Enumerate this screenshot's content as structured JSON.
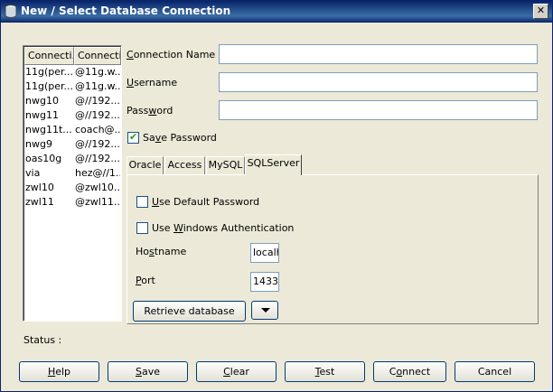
{
  "window": {
    "title": "New / Select Database Connection",
    "close_glyph": "✕"
  },
  "connections": {
    "columns": [
      "Connecti...",
      "Connecti..."
    ],
    "rows": [
      {
        "name": "11g(per...",
        "conn": "@11g.w..."
      },
      {
        "name": "11g(per...",
        "conn": "@11g.w..."
      },
      {
        "name": "nwg10",
        "conn": "@//192...."
      },
      {
        "name": "nwg11",
        "conn": "@//192...."
      },
      {
        "name": "nwg11t...",
        "conn": "coach@..."
      },
      {
        "name": "nwg9",
        "conn": "@//192...."
      },
      {
        "name": "oas10g",
        "conn": "@//192...."
      },
      {
        "name": "via",
        "conn": "hez@//1..."
      },
      {
        "name": "zwl10",
        "conn": "@zwl10..."
      },
      {
        "name": "zwl11",
        "conn": "@zwl11..."
      }
    ]
  },
  "form": {
    "connection_name": {
      "label_pre": "",
      "label_mn": "C",
      "label_post": "onnection Name",
      "value": ""
    },
    "username": {
      "label_pre": "",
      "label_mn": "U",
      "label_post": "sername",
      "value": ""
    },
    "password": {
      "label_pre": "Pass",
      "label_mn": "w",
      "label_post": "ord",
      "value": ""
    },
    "save_password": {
      "label_pre": "Sa",
      "label_mn": "v",
      "label_post": "e Password",
      "checked": true
    }
  },
  "tabs": [
    {
      "label": "Oracle",
      "active": false
    },
    {
      "label": "Access",
      "active": false
    },
    {
      "label": "MySQL",
      "active": false
    },
    {
      "label": "SQLServer",
      "active": true
    }
  ],
  "sqlserver": {
    "use_default_password": {
      "label_pre": "",
      "label_mn": "U",
      "label_post": "se Default Password",
      "checked": false
    },
    "use_windows_auth": {
      "label_pre": "Use ",
      "label_mn": "W",
      "label_post": "indows Authentication",
      "checked": false
    },
    "hostname": {
      "label_pre": "Ho",
      "label_mn": "s",
      "label_post": "tname",
      "value": "localh"
    },
    "port": {
      "label_pre": "",
      "label_mn": "P",
      "label_post": "ort",
      "value": "1433"
    },
    "retrieve_label": "Retrieve database"
  },
  "status": {
    "label": "Status :",
    "value": ""
  },
  "buttons": {
    "help": {
      "mn": "H",
      "rest": "elp"
    },
    "save": {
      "mn": "S",
      "rest": "ave"
    },
    "clear": {
      "mn": "C",
      "rest": "lear"
    },
    "test": {
      "mn": "T",
      "rest": "est"
    },
    "connect_pre": "C",
    "connect_mn": "o",
    "connect_post": "nnect",
    "cancel": "Cancel"
  },
  "colors": {
    "title_bar": "#0a246a",
    "dialog_bg": "#ece9d8",
    "field_border": "#7f9db9"
  }
}
